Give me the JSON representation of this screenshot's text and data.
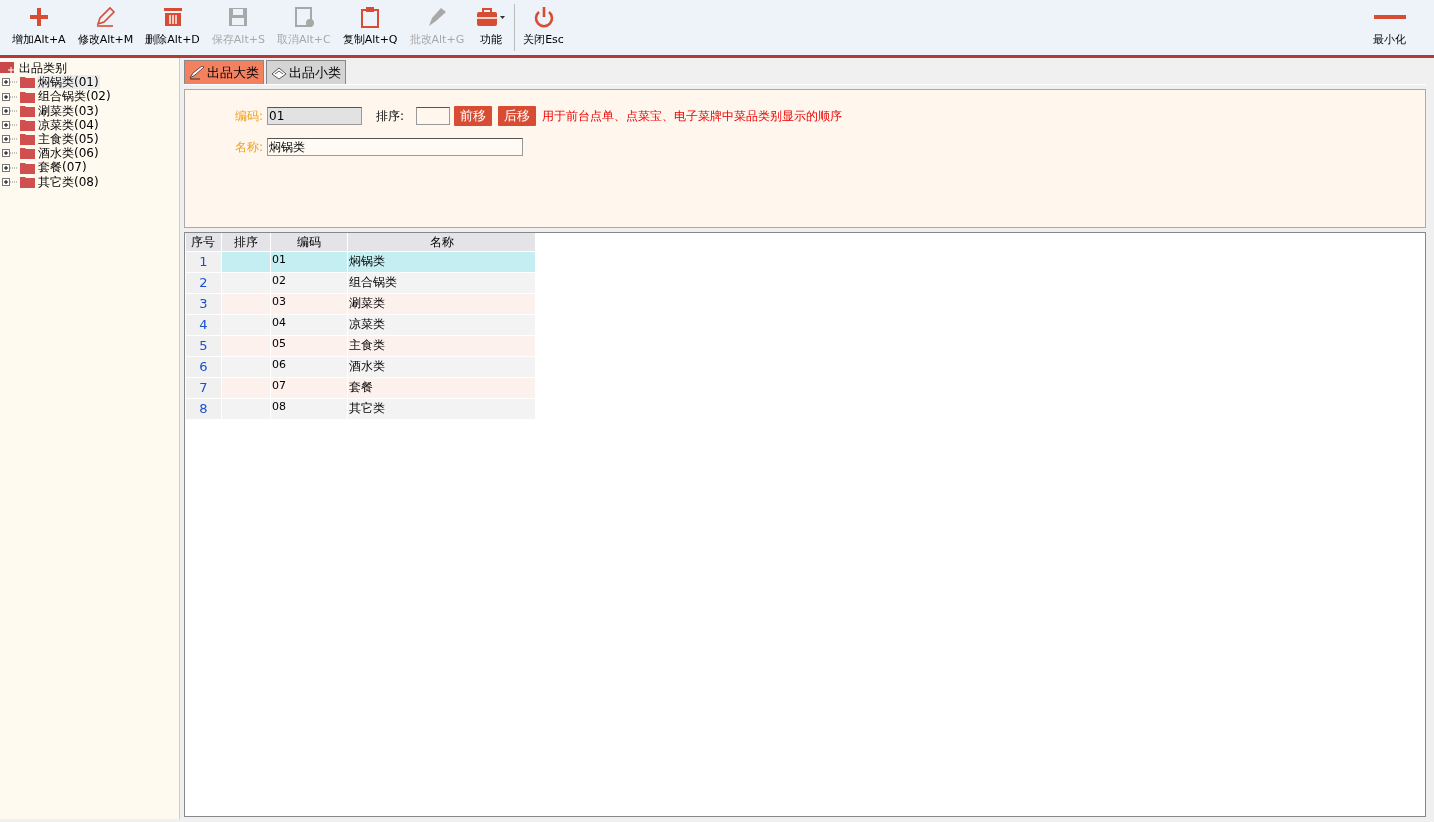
{
  "toolbar": [
    {
      "kind": "plus",
      "label": "增加Alt+A",
      "disabled": false
    },
    {
      "kind": "pencil",
      "label": "修改Alt+M",
      "disabled": false
    },
    {
      "kind": "trash",
      "label": "删除Alt+D",
      "disabled": false
    },
    {
      "kind": "save",
      "label": "保存Alt+S",
      "disabled": true
    },
    {
      "kind": "cancel",
      "label": "取消Alt+C",
      "disabled": true
    },
    {
      "kind": "clipboard",
      "label": "复制Alt+Q",
      "disabled": false
    },
    {
      "kind": "pen",
      "label": "批改Alt+G",
      "disabled": true
    },
    {
      "kind": "toolbox",
      "label": "功能",
      "disabled": false
    },
    {
      "kind": "power",
      "label": "关闭Esc",
      "disabled": false
    }
  ],
  "minimize": {
    "label": "最小化"
  },
  "tree": {
    "label": "出品类别",
    "children": [
      {
        "label": "焖锅类(01)",
        "selected": true
      },
      {
        "label": "组合锅类(02)",
        "selected": false
      },
      {
        "label": "涮菜类(03)",
        "selected": false
      },
      {
        "label": "凉菜类(04)",
        "selected": false
      },
      {
        "label": "主食类(05)",
        "selected": false
      },
      {
        "label": "酒水类(06)",
        "selected": false
      },
      {
        "label": "套餐(07)",
        "selected": false
      },
      {
        "label": "其它类(08)",
        "selected": false
      }
    ]
  },
  "tabs": [
    {
      "label": "出品大类",
      "selected": true
    },
    {
      "label": "出品小类",
      "selected": false
    }
  ],
  "form": {
    "code_label": "编码:",
    "code_value": "01",
    "order_label": "排序:",
    "prev_button": "前移",
    "next_button": "后移",
    "hint": "用于前台点单、点菜宝、电子菜牌中菜品类别显示的顺序",
    "name_label": "名称:",
    "name_value": "焖锅类"
  },
  "table": {
    "columns": [
      "序号",
      "排序",
      "编码",
      "名称"
    ],
    "rows": [
      {
        "no": "1",
        "code": "01",
        "name": "焖锅类",
        "selected": true
      },
      {
        "no": "2",
        "code": "02",
        "name": "组合锅类",
        "selected": false
      },
      {
        "no": "3",
        "code": "03",
        "name": "涮菜类",
        "selected": false
      },
      {
        "no": "4",
        "code": "04",
        "name": "凉菜类",
        "selected": false
      },
      {
        "no": "5",
        "code": "05",
        "name": "主食类",
        "selected": false
      },
      {
        "no": "6",
        "code": "06",
        "name": "酒水类",
        "selected": false
      },
      {
        "no": "7",
        "code": "07",
        "name": "套餐",
        "selected": false
      },
      {
        "no": "8",
        "code": "08",
        "name": "其它类",
        "selected": false
      }
    ]
  }
}
